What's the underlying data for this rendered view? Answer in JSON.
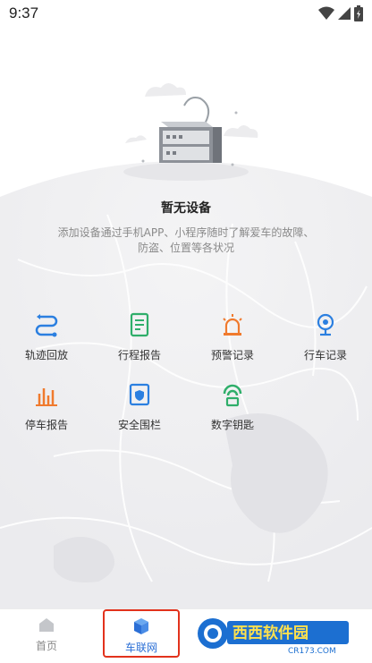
{
  "status_bar": {
    "time": "9:37",
    "icons": [
      "wifi-icon",
      "cellular-signal-icon",
      "battery-charging-icon"
    ]
  },
  "empty_state": {
    "title": "暂无设备",
    "description": "添加设备通过手机APP、小程序随时了解爱车的故障、防盗、位置等各状况",
    "illustration": "server-device-illustration"
  },
  "features": [
    {
      "label": "轨迹回放",
      "icon": "route-replay-icon",
      "color": "#2b7fe0"
    },
    {
      "label": "行程报告",
      "icon": "trip-report-icon",
      "color": "#2fae6a"
    },
    {
      "label": "预警记录",
      "icon": "alarm-light-icon",
      "color": "#f07a2d"
    },
    {
      "label": "行车记录",
      "icon": "dashcam-icon",
      "color": "#2b7fe0"
    },
    {
      "label": "停车报告",
      "icon": "parking-report-icon",
      "color": "#f07a2d"
    },
    {
      "label": "安全围栏",
      "icon": "geofence-shield-icon",
      "color": "#2b7fe0"
    },
    {
      "label": "数字钥匙",
      "icon": "digital-key-icon",
      "color": "#2fae6a"
    }
  ],
  "tabbar": {
    "home": {
      "label": "首页",
      "icon": "home-icon"
    },
    "iov": {
      "label": "车联网",
      "icon": "cube-icon",
      "active": true
    }
  },
  "watermark": {
    "text": "西西软件园",
    "subtext": "CR173.COM"
  },
  "colors": {
    "accent_blue": "#2b6fd6",
    "highlight_border": "#e2321c",
    "muted_text": "#8a8a8a"
  }
}
